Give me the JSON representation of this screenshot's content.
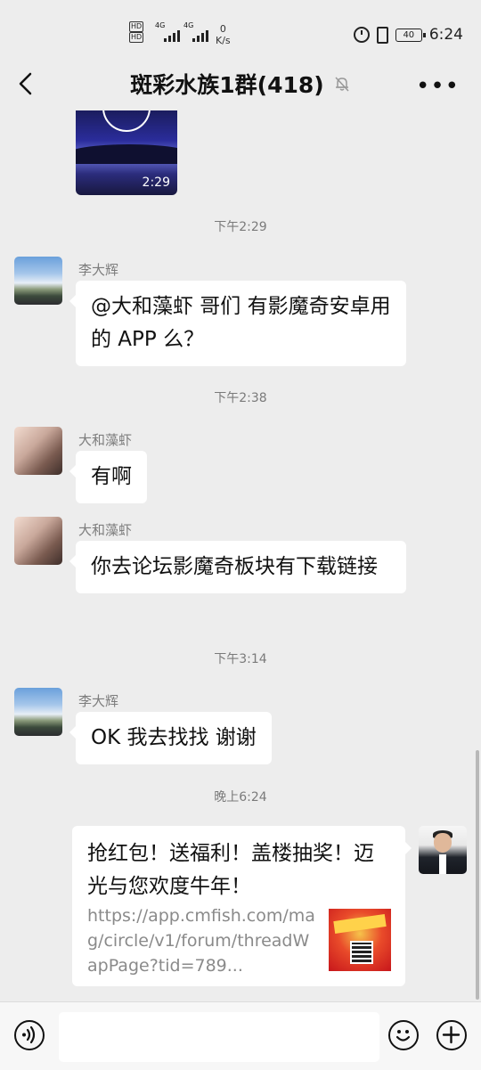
{
  "status_bar": {
    "hd1": "HD",
    "hd2": "HD",
    "net1": "4G",
    "net2": "4G",
    "speed_value": "0",
    "speed_unit": "K/s",
    "battery": "40",
    "time": "6:24",
    "icons": [
      "alarm-icon",
      "vibrate-icon",
      "battery-icon"
    ]
  },
  "header": {
    "title": "斑彩水族1群(418)",
    "back_icon": "chevron-left-icon",
    "mute_icon": "bell-off-icon",
    "more_icon": "more-icon",
    "more_label": "•••"
  },
  "messages": {
    "video": {
      "duration": "2:29"
    },
    "time1": "下午2:29",
    "m1": {
      "sender": "李大辉",
      "text": "@大和藻虾  哥们  有影魔奇安卓用的 APP 么？"
    },
    "time2": "下午2:38",
    "m2": {
      "sender": "大和藻虾",
      "text": "有啊"
    },
    "m3": {
      "sender": "大和藻虾",
      "text": "你去论坛影魔奇板块有下载链接"
    },
    "time3": "下午3:14",
    "m4": {
      "sender": "李大辉",
      "text": "OK 我去找找 谢谢"
    },
    "time4": "晚上6:24",
    "card": {
      "title": "抢红包！送福利！盖楼抽奖！迈光与您欢度牛年！",
      "desc": "https://app.cmfish.com/mag/circle/v1/forum/threadWapPage?tid=789..."
    }
  },
  "input_bar": {
    "voice_icon": "voice-icon",
    "emoji_icon": "emoji-icon",
    "plus_icon": "plus-icon",
    "text_value": ""
  }
}
